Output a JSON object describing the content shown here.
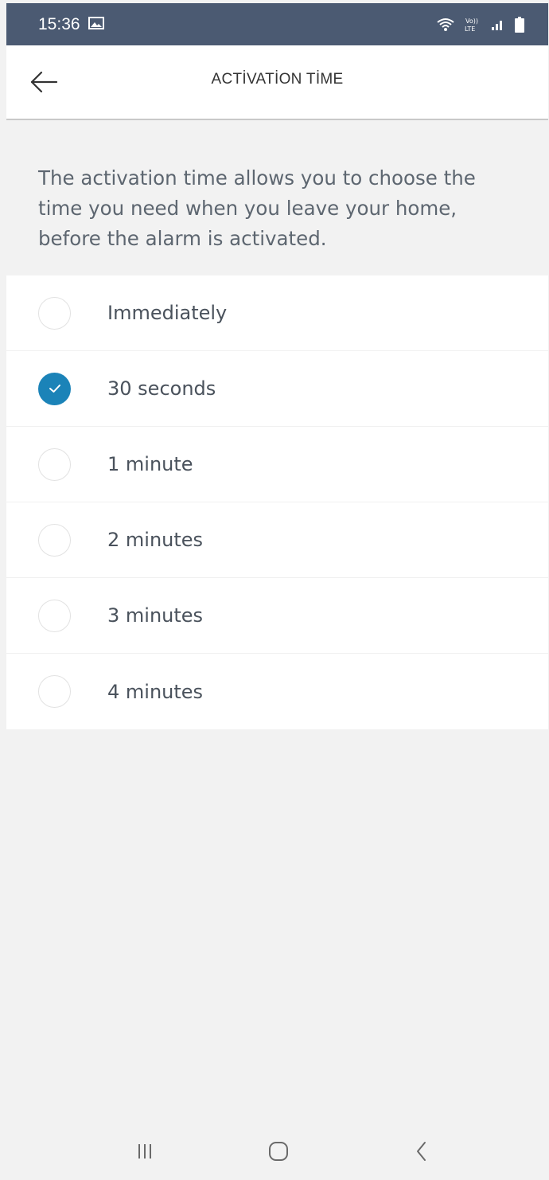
{
  "status_bar": {
    "time": "15:36",
    "icons": [
      "gallery-icon",
      "wifi-icon",
      "volte-lte-icon",
      "signal-icon",
      "battery-icon"
    ]
  },
  "header": {
    "title": "ACTİVATİON TİME",
    "back_icon": "arrow-left-icon"
  },
  "description": "The activation time allows you to choose the time you need when you leave your home, before the alarm is activated.",
  "options": [
    {
      "label": "Immediately",
      "selected": false
    },
    {
      "label": "30 seconds",
      "selected": true
    },
    {
      "label": "1 minute",
      "selected": false
    },
    {
      "label": "2 minutes",
      "selected": false
    },
    {
      "label": "3 minutes",
      "selected": false
    },
    {
      "label": "4 minutes",
      "selected": false
    }
  ],
  "nav_bar": {
    "icons": [
      "recent-apps-icon",
      "home-icon",
      "back-icon"
    ]
  },
  "colors": {
    "status_bar": "#4b5a72",
    "accent": "#1b83b8",
    "background": "#f2f2f2"
  }
}
